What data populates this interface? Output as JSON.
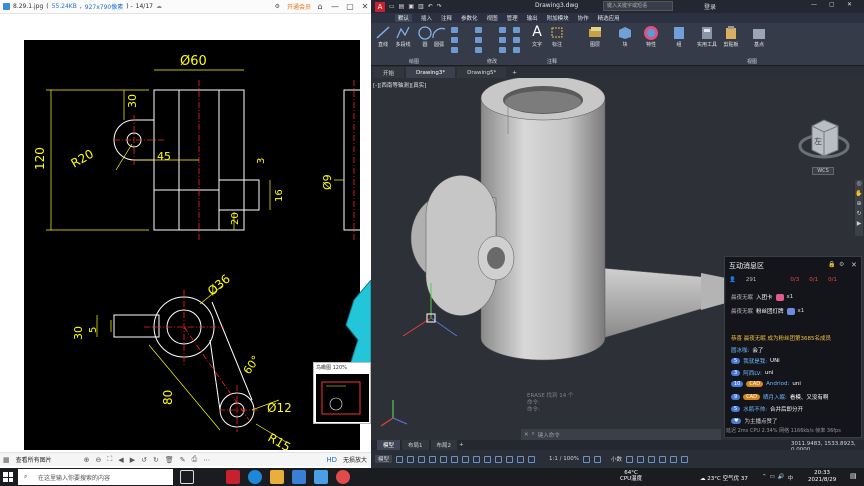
{
  "viewer": {
    "filename": "8.29.1.jpg",
    "filesize": "55.24KB",
    "dims": "927x790像素",
    "page": "14/17",
    "open_label": "开通会员",
    "view_all_label": "查看所有图片",
    "fit_label": "无损放大",
    "nav_title": "鸟瞰图 120%"
  },
  "drawing_dims": {
    "d60": "Ø60",
    "d30_top": "30",
    "d120": "120",
    "r20": "R20",
    "d45": "45",
    "d3": "3",
    "d16": "16",
    "d20": "20",
    "d9": "Ø9",
    "d36": "Ø36",
    "d30_left": "30",
    "d5": "5",
    "angle60": "60°",
    "d80": "80",
    "d12": "Ø12",
    "r15": "R15"
  },
  "acad": {
    "title": "Drawing3.dwg",
    "search_placeholder": "键入关键字或短语",
    "login": "登录",
    "menus": [
      "默认",
      "插入",
      "注释",
      "参数化",
      "视图",
      "管理",
      "输出",
      "附加模块",
      "协作",
      "精选应用"
    ],
    "tools": [
      {
        "label": "直线"
      },
      {
        "label": "多段线"
      },
      {
        "label": "圆"
      },
      {
        "label": "圆弧"
      },
      {
        "label": "文字"
      },
      {
        "label": "标注"
      },
      {
        "label": "图层"
      },
      {
        "label": "块"
      },
      {
        "label": "特性"
      },
      {
        "label": "组"
      },
      {
        "label": "实用工具"
      },
      {
        "label": "剪贴板"
      },
      {
        "label": "基点"
      }
    ],
    "panels": [
      "绘图",
      "修改",
      "注释",
      "视图"
    ],
    "tabs": [
      "开始",
      "Drawing3*",
      "Drawing5*"
    ],
    "viewport_label": "[-][西南等轴测][真实]",
    "wcs_label": "WCS",
    "cube_label": "左",
    "cmd_history": [
      "ERASE 找到 14 个",
      "命令:",
      "命令:"
    ],
    "cmd_placeholder": "键入命令",
    "layout_tabs": [
      "模型",
      "布局1",
      "布局2"
    ],
    "coords": "3011.9483, 1533.8923, 0.0000",
    "status_model": "模型",
    "status_scale": "1:1 / 100%",
    "status_units": "小数"
  },
  "chat": {
    "title": "互动消息区",
    "stats": [
      "291",
      "0/3",
      "0/1",
      "0/1"
    ],
    "messages": [
      {
        "user": "晨夜无眠",
        "text": "入团卡",
        "extra": "x1"
      },
      {
        "user": "晨夜无眠",
        "text": "粉丝团灯牌",
        "extra": "x1"
      },
      {
        "user": "",
        "text": "恭喜 晨夜无眠 成为粉丝团第3685名成员",
        "extra": ""
      },
      {
        "user": "圆冰咖:",
        "text": "会了",
        "extra": ""
      },
      {
        "user": "我就是我:",
        "text": "UNi",
        "extra": ""
      },
      {
        "user": "阿西LV:",
        "text": "uni",
        "extra": ""
      },
      {
        "user": "Andriod:",
        "text": "uni",
        "extra": ""
      },
      {
        "user": "晒月入眠:",
        "text": "看模、又没有啊",
        "extra": ""
      },
      {
        "user": "水瓶不帅:",
        "text": "合并后即分开",
        "extra": ""
      },
      {
        "user": "",
        "text": "为主播点赞了",
        "extra": ""
      }
    ],
    "footer": "延迟 2ms    CPU 2.34%    网络 1166kb/s    帧率 36fps"
  },
  "taskbar": {
    "search_placeholder": "在这里输入你要搜索的内容",
    "temp_cpu": "64°C",
    "cpu_label": "CPU温度",
    "weather": "23°C  空气优 37",
    "time": "20:33",
    "date": "2021/8/29"
  },
  "colors": {
    "cad_yellow": "#ffff00",
    "cad_red": "#ff2020",
    "cad_cyan": "#22c6d8",
    "acad_bg": "#2d3036",
    "model_gray": "#bcbcbc"
  }
}
